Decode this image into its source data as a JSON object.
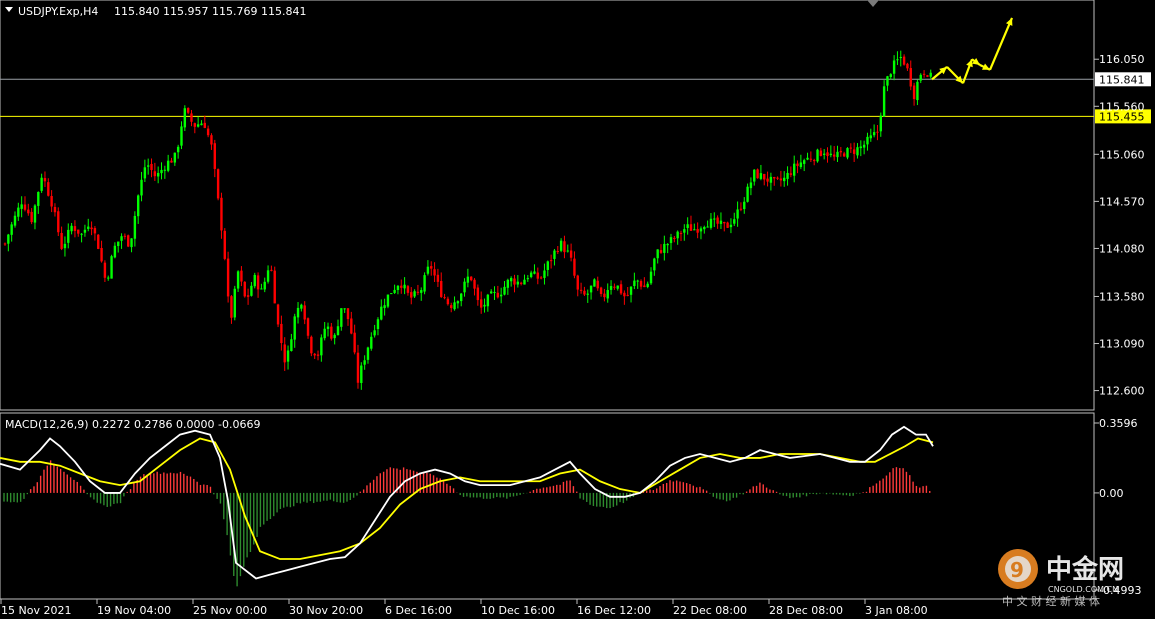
{
  "chart_data": [
    {
      "type": "candlestick",
      "header": {
        "symbol": "USDJPY.Exp,H4",
        "ohlc": "115.840 115.957 115.769 115.841"
      },
      "y_ticks": [
        "116.050",
        "115.560",
        "115.060",
        "114.570",
        "114.080",
        "113.580",
        "113.090",
        "112.600"
      ],
      "ylim": [
        112.45,
        116.5
      ],
      "horizontal_lines": [
        {
          "value": 115.841,
          "label": "115.841",
          "color": "#9aa0a6",
          "label_bg": "#ffffff",
          "label_fg": "#000000"
        },
        {
          "value": 115.455,
          "label": "115.455",
          "color": "#ffff00",
          "label_bg": "#ffff00",
          "label_fg": "#000000"
        }
      ],
      "up_color": "#00ff00",
      "down_color": "#ff0000",
      "close_path": [
        [
          0,
          113.98
        ],
        [
          10,
          114.28
        ],
        [
          22,
          114.58
        ],
        [
          32,
          114.38
        ],
        [
          42,
          114.86
        ],
        [
          52,
          114.55
        ],
        [
          62,
          114.08
        ],
        [
          72,
          114.32
        ],
        [
          82,
          114.22
        ],
        [
          90,
          114.38
        ],
        [
          98,
          114.12
        ],
        [
          106,
          113.72
        ],
        [
          114,
          114.08
        ],
        [
          122,
          114.22
        ],
        [
          130,
          114.12
        ],
        [
          138,
          114.62
        ],
        [
          146,
          114.98
        ],
        [
          156,
          114.82
        ],
        [
          166,
          114.96
        ],
        [
          176,
          115.04
        ],
        [
          184,
          115.52
        ],
        [
          194,
          115.36
        ],
        [
          204,
          115.4
        ],
        [
          212,
          115.12
        ],
        [
          218,
          114.58
        ],
        [
          224,
          114.1
        ],
        [
          230,
          113.28
        ],
        [
          238,
          113.84
        ],
        [
          246,
          113.52
        ],
        [
          254,
          113.78
        ],
        [
          262,
          113.62
        ],
        [
          270,
          113.96
        ],
        [
          278,
          113.28
        ],
        [
          286,
          112.86
        ],
        [
          294,
          113.34
        ],
        [
          302,
          113.56
        ],
        [
          310,
          113.04
        ],
        [
          318,
          112.98
        ],
        [
          326,
          113.3
        ],
        [
          334,
          113.12
        ],
        [
          342,
          113.5
        ],
        [
          350,
          113.3
        ],
        [
          358,
          112.7
        ],
        [
          366,
          113.0
        ],
        [
          374,
          113.26
        ],
        [
          382,
          113.48
        ],
        [
          390,
          113.62
        ],
        [
          400,
          113.74
        ],
        [
          410,
          113.56
        ],
        [
          420,
          113.62
        ],
        [
          430,
          113.92
        ],
        [
          440,
          113.64
        ],
        [
          450,
          113.48
        ],
        [
          460,
          113.6
        ],
        [
          470,
          113.82
        ],
        [
          480,
          113.44
        ],
        [
          490,
          113.58
        ],
        [
          500,
          113.62
        ],
        [
          510,
          113.76
        ],
        [
          520,
          113.72
        ],
        [
          530,
          113.82
        ],
        [
          540,
          113.76
        ],
        [
          550,
          113.96
        ],
        [
          560,
          114.14
        ],
        [
          570,
          114.0
        ],
        [
          578,
          113.62
        ],
        [
          586,
          113.58
        ],
        [
          594,
          113.72
        ],
        [
          602,
          113.54
        ],
        [
          610,
          113.72
        ],
        [
          618,
          113.68
        ],
        [
          626,
          113.56
        ],
        [
          636,
          113.76
        ],
        [
          646,
          113.66
        ],
        [
          656,
          114.02
        ],
        [
          666,
          114.12
        ],
        [
          676,
          114.2
        ],
        [
          686,
          114.3
        ],
        [
          696,
          114.28
        ],
        [
          706,
          114.36
        ],
        [
          716,
          114.34
        ],
        [
          726,
          114.3
        ],
        [
          736,
          114.42
        ],
        [
          746,
          114.64
        ],
        [
          754,
          114.86
        ],
        [
          764,
          114.82
        ],
        [
          774,
          114.76
        ],
        [
          784,
          114.8
        ],
        [
          794,
          114.92
        ],
        [
          804,
          115.0
        ],
        [
          814,
          115.04
        ],
        [
          824,
          115.1
        ],
        [
          834,
          115.02
        ],
        [
          844,
          115.08
        ],
        [
          854,
          115.1
        ],
        [
          862,
          115.14
        ],
        [
          870,
          115.22
        ],
        [
          878,
          115.3
        ],
        [
          884,
          115.74
        ],
        [
          890,
          115.92
        ],
        [
          896,
          116.02
        ],
        [
          902,
          116.08
        ],
        [
          908,
          115.92
        ],
        [
          914,
          115.68
        ],
        [
          920,
          115.9
        ],
        [
          926,
          115.94
        ],
        [
          932,
          115.84
        ]
      ],
      "forecast_arrows_description": "yellow zigzag arrows projecting higher",
      "forecast_points": [
        [
          932,
          115.84
        ],
        [
          947,
          115.97
        ],
        [
          963,
          115.8
        ],
        [
          972,
          116.05
        ],
        [
          980,
          115.99
        ],
        [
          990,
          115.94
        ],
        [
          1012,
          116.48
        ]
      ]
    },
    {
      "type": "macd",
      "header": "MACD(12,26,9) 0.2272 0.2786 0.0000 -0.0669",
      "y_ticks": [
        "0.3596",
        "0.00",
        "-0.4993"
      ],
      "ylim": [
        -0.4993,
        0.3596
      ],
      "macd_color": "#ffffff",
      "signal_color": "#ffff00",
      "histogram_up_color": "#ff3b3b",
      "histogram_down_color": "#2e8b2e",
      "macd_path": [
        [
          0,
          0.15
        ],
        [
          20,
          0.12
        ],
        [
          40,
          0.22
        ],
        [
          50,
          0.28
        ],
        [
          60,
          0.24
        ],
        [
          75,
          0.16
        ],
        [
          90,
          0.06
        ],
        [
          105,
          0.0
        ],
        [
          120,
          0.0
        ],
        [
          135,
          0.1
        ],
        [
          150,
          0.18
        ],
        [
          165,
          0.24
        ],
        [
          180,
          0.3
        ],
        [
          195,
          0.32
        ],
        [
          210,
          0.3
        ],
        [
          220,
          0.18
        ],
        [
          228,
          -0.04
        ],
        [
          236,
          -0.36
        ],
        [
          246,
          -0.4
        ],
        [
          256,
          -0.44
        ],
        [
          270,
          -0.42
        ],
        [
          285,
          -0.4
        ],
        [
          300,
          -0.38
        ],
        [
          315,
          -0.36
        ],
        [
          330,
          -0.34
        ],
        [
          345,
          -0.33
        ],
        [
          360,
          -0.26
        ],
        [
          375,
          -0.14
        ],
        [
          390,
          -0.02
        ],
        [
          405,
          0.06
        ],
        [
          420,
          0.1
        ],
        [
          435,
          0.12
        ],
        [
          450,
          0.1
        ],
        [
          465,
          0.06
        ],
        [
          480,
          0.04
        ],
        [
          495,
          0.04
        ],
        [
          510,
          0.04
        ],
        [
          525,
          0.06
        ],
        [
          540,
          0.08
        ],
        [
          555,
          0.12
        ],
        [
          570,
          0.16
        ],
        [
          580,
          0.1
        ],
        [
          595,
          0.02
        ],
        [
          610,
          -0.02
        ],
        [
          625,
          -0.02
        ],
        [
          640,
          0.0
        ],
        [
          655,
          0.06
        ],
        [
          670,
          0.14
        ],
        [
          685,
          0.18
        ],
        [
          700,
          0.2
        ],
        [
          715,
          0.18
        ],
        [
          730,
          0.16
        ],
        [
          745,
          0.18
        ],
        [
          760,
          0.22
        ],
        [
          775,
          0.2
        ],
        [
          790,
          0.18
        ],
        [
          805,
          0.19
        ],
        [
          820,
          0.2
        ],
        [
          835,
          0.18
        ],
        [
          850,
          0.16
        ],
        [
          865,
          0.16
        ],
        [
          880,
          0.22
        ],
        [
          892,
          0.3
        ],
        [
          904,
          0.34
        ],
        [
          916,
          0.3
        ],
        [
          926,
          0.3
        ],
        [
          933,
          0.24
        ]
      ],
      "signal_path": [
        [
          0,
          0.18
        ],
        [
          20,
          0.16
        ],
        [
          40,
          0.16
        ],
        [
          60,
          0.14
        ],
        [
          80,
          0.1
        ],
        [
          100,
          0.06
        ],
        [
          120,
          0.04
        ],
        [
          140,
          0.06
        ],
        [
          160,
          0.14
        ],
        [
          180,
          0.22
        ],
        [
          200,
          0.28
        ],
        [
          215,
          0.26
        ],
        [
          230,
          0.12
        ],
        [
          245,
          -0.12
        ],
        [
          260,
          -0.3
        ],
        [
          280,
          -0.34
        ],
        [
          300,
          -0.34
        ],
        [
          320,
          -0.32
        ],
        [
          340,
          -0.3
        ],
        [
          360,
          -0.26
        ],
        [
          380,
          -0.18
        ],
        [
          400,
          -0.06
        ],
        [
          420,
          0.02
        ],
        [
          440,
          0.06
        ],
        [
          460,
          0.08
        ],
        [
          480,
          0.06
        ],
        [
          500,
          0.06
        ],
        [
          520,
          0.06
        ],
        [
          540,
          0.06
        ],
        [
          560,
          0.1
        ],
        [
          580,
          0.12
        ],
        [
          600,
          0.06
        ],
        [
          620,
          0.02
        ],
        [
          640,
          0.0
        ],
        [
          660,
          0.06
        ],
        [
          680,
          0.12
        ],
        [
          700,
          0.18
        ],
        [
          720,
          0.2
        ],
        [
          740,
          0.18
        ],
        [
          760,
          0.18
        ],
        [
          780,
          0.2
        ],
        [
          800,
          0.2
        ],
        [
          820,
          0.2
        ],
        [
          840,
          0.18
        ],
        [
          860,
          0.16
        ],
        [
          875,
          0.16
        ],
        [
          890,
          0.2
        ],
        [
          905,
          0.24
        ],
        [
          918,
          0.28
        ],
        [
          933,
          0.26
        ]
      ]
    }
  ],
  "x_axis_labels": [
    "15 Nov 2021",
    "19 Nov 04:00",
    "25 Nov 00:00",
    "30 Nov 20:00",
    "6 Dec 16:00",
    "10 Dec 16:00",
    "16 Dec 12:00",
    "22 Dec 08:00",
    "28 Dec 08:00",
    "3 Jan 08:00"
  ],
  "watermark": {
    "brand_text": "中金网",
    "sub_text": "CNGOLD.COM.CN",
    "tagline": "中 文 财 经 新 媒 体"
  }
}
